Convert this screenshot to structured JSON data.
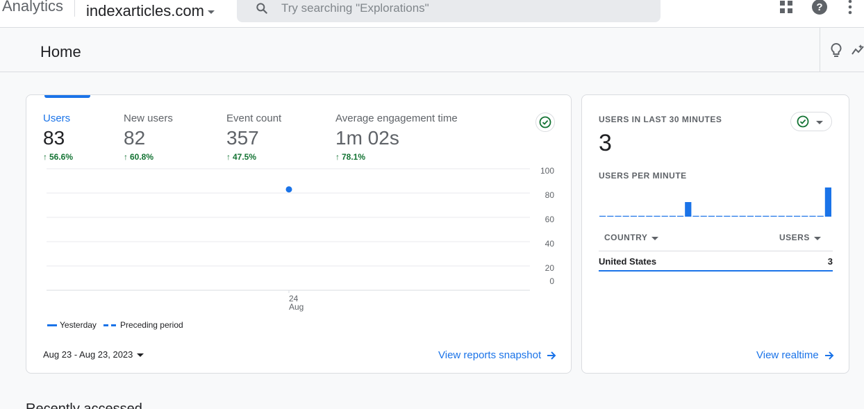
{
  "topbar": {
    "brand": "Analytics",
    "property": "indexarticles.com",
    "search_placeholder": "Try searching \"Explorations\""
  },
  "header": {
    "title": "Home"
  },
  "overview": {
    "metrics": [
      {
        "label": "Users",
        "value": "83",
        "change": "56.6%"
      },
      {
        "label": "New users",
        "value": "82",
        "change": "60.8%"
      },
      {
        "label": "Event count",
        "value": "357",
        "change": "47.5%"
      },
      {
        "label": "Average engagement time",
        "value": "1m 02s",
        "change": "78.1%"
      }
    ],
    "legend": {
      "yesterday": "Yesterday",
      "preceding": "Preceding period"
    },
    "date_range": "Aug 23 - Aug 23, 2023",
    "view_link": "View reports snapshot"
  },
  "chart_data": {
    "type": "line",
    "x": [
      "24 Aug"
    ],
    "x_tick": {
      "day": "24",
      "month": "Aug"
    },
    "series": [
      {
        "name": "Yesterday",
        "values": [
          83
        ]
      }
    ],
    "yticks": [
      0,
      20,
      40,
      60,
      80,
      100
    ],
    "ylim": [
      0,
      100
    ],
    "grid": true,
    "legend_placement": "bottom-left"
  },
  "realtime": {
    "title": "USERS IN LAST 30 MINUTES",
    "value": "3",
    "subtitle": "USERS PER MINUTE",
    "per_minute": [
      0,
      0,
      0,
      0,
      0,
      0,
      0,
      0,
      0,
      0,
      0,
      1,
      0,
      0,
      0,
      0,
      0,
      0,
      0,
      0,
      0,
      0,
      0,
      0,
      0,
      0,
      0,
      0,
      0,
      2
    ],
    "table": {
      "col_country": "COUNTRY",
      "col_users": "USERS",
      "rows": [
        {
          "country": "United States",
          "users": "3"
        }
      ]
    },
    "view_link": "View realtime"
  },
  "bottom": {
    "heading": "Recently accessed"
  },
  "colors": {
    "accent": "#1a73e8",
    "positive": "#137333"
  }
}
